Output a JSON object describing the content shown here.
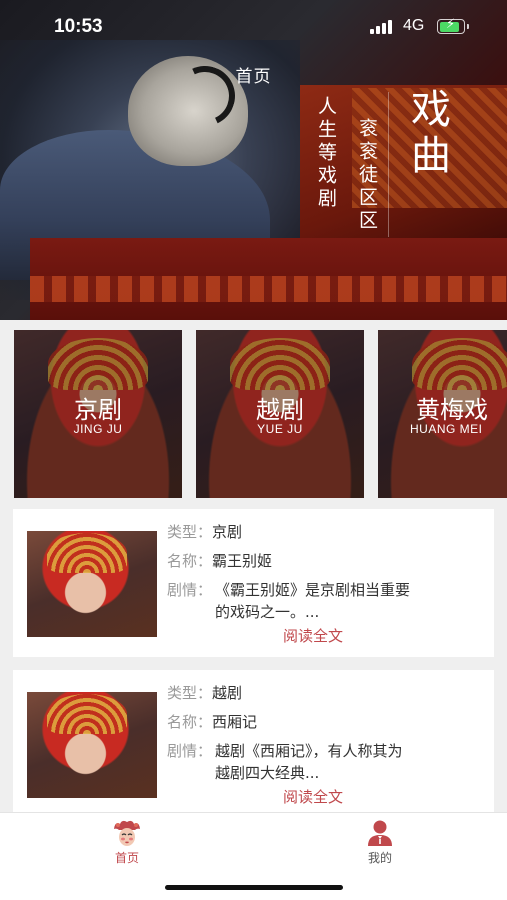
{
  "status_bar": {
    "time": "10:53",
    "network": "4G",
    "battery_level": 0.85,
    "battery_color": "#4cd964"
  },
  "hero": {
    "title": "首页",
    "vertical_main": "戏曲",
    "vertical_sub1": "人生等戏剧",
    "vertical_sub2": "衮衮徒区区"
  },
  "categories": [
    {
      "name": "京剧",
      "pinyin": "JING JU"
    },
    {
      "name": "越剧",
      "pinyin": "YUE JU"
    },
    {
      "name": "黄梅戏",
      "pinyin": "HUANG MEI"
    }
  ],
  "list": {
    "labels": {
      "type": "类型：",
      "name": "名称：",
      "plot": "剧情："
    },
    "read_more": "阅读全文",
    "accent_color": "#c0484c",
    "items": [
      {
        "type": "京剧",
        "name": "霸王别姬",
        "plot": "《霸王别姬》是京剧相当重要的戏码之一。..."
      },
      {
        "type": "越剧",
        "name": "西厢记",
        "plot": "越剧《西厢记》，有人称其为越剧四大经典..."
      }
    ]
  },
  "tab_bar": {
    "home_label": "首页",
    "home_icon": "opera-mask-icon",
    "mine_label": "我的",
    "mine_icon": "user-icon"
  }
}
